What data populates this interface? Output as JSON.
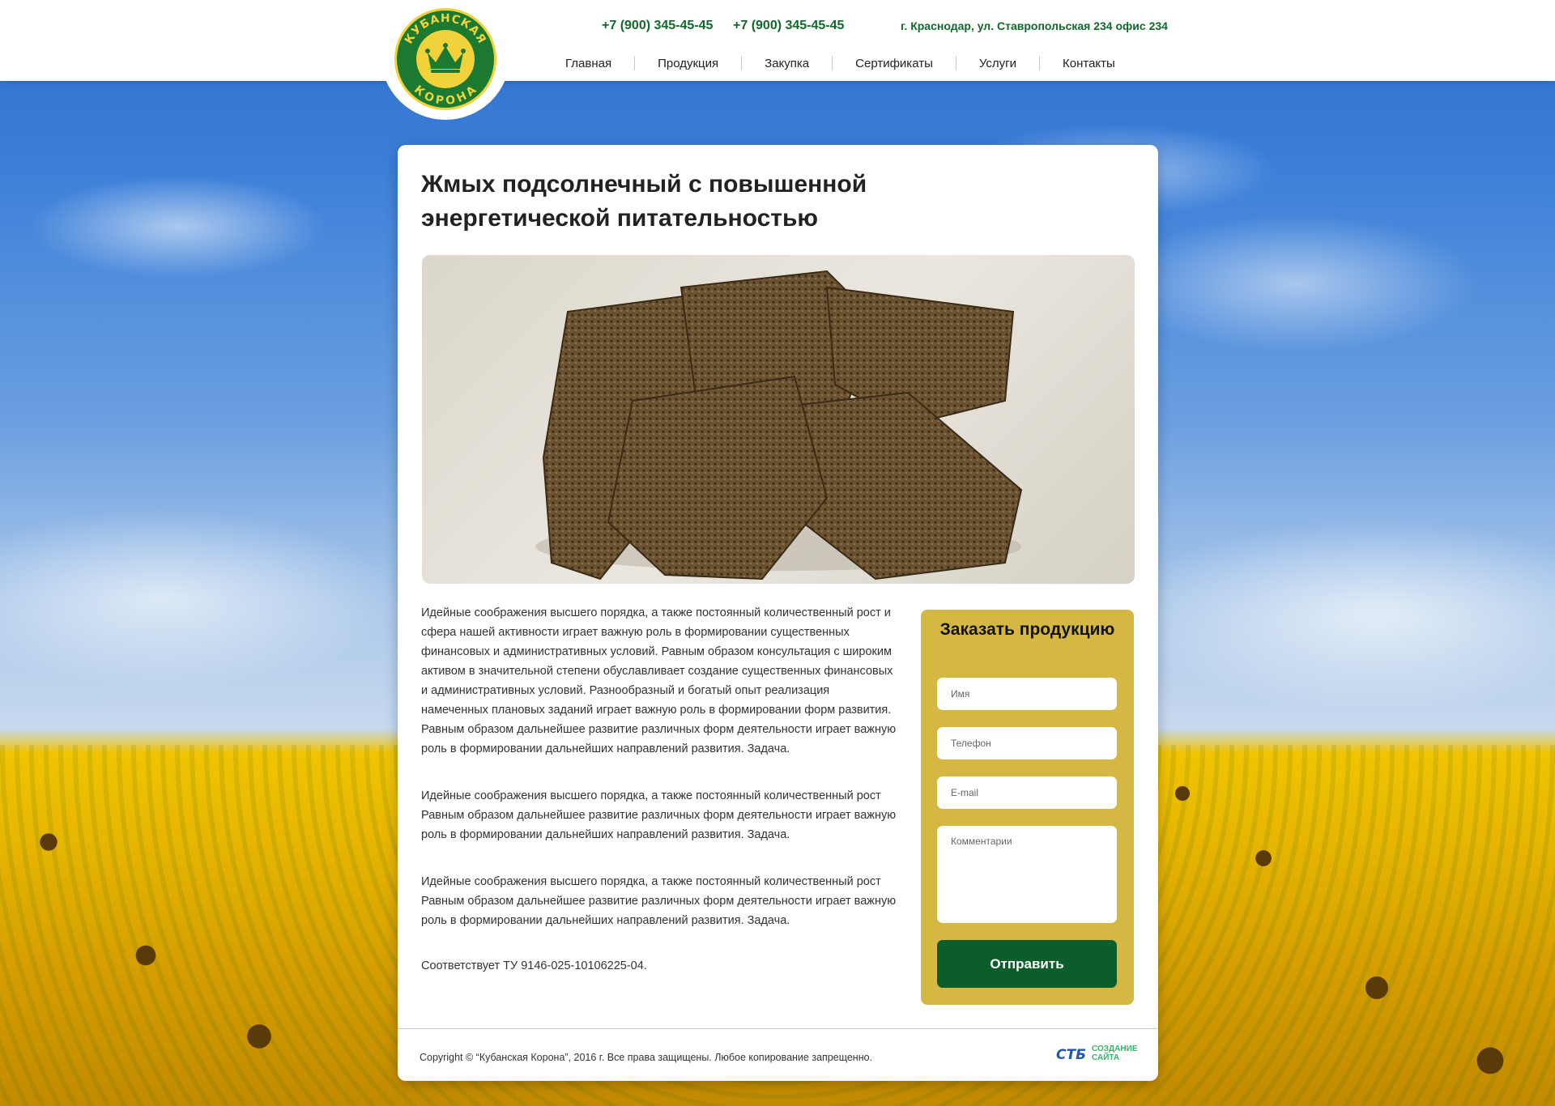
{
  "header": {
    "logo_top": "КУБАНСКАЯ",
    "logo_bottom": "КОРОНА",
    "phone1": "+7 (900) 345-45-45",
    "phone2": "+7 (900) 345-45-45",
    "address": "г. Краснодар, ул. Ставропольская 234 офис 234"
  },
  "nav": {
    "items": [
      {
        "label": "Главная"
      },
      {
        "label": "Продукция"
      },
      {
        "label": "Закупка"
      },
      {
        "label": "Сертификаты"
      },
      {
        "label": "Услуги"
      },
      {
        "label": "Контакты"
      }
    ]
  },
  "product": {
    "title": "Жмых подсолнечный с повышенной энергетической питательностью",
    "paragraphs": [
      "Идейные соображения высшего порядка, а также постоянный количественный рост и сфера нашей активности играет важную роль в формировании существенных финансовых и административных условий. Равным образом консультация с широким активом в значительной степени обуславливает создание существенных финансовых и административных условий. Разнообразный и богатый опыт реализация намеченных плановых заданий играет важную роль в формировании форм развития.",
      "Равным образом дальнейшее развитие различных форм деятельности играет важную роль в формировании дальнейших направлений развития. Задача.",
      "Идейные соображения высшего порядка, а также постоянный количественный рост",
      "Равным образом дальнейшее развитие различных форм деятельности играет важную роль в формировании дальнейших направлений развития. Задача.",
      "Идейные соображения высшего порядка, а также постоянный количественный рост",
      "Равным образом дальнейшее развитие различных форм деятельности играет важную роль в формировании дальнейших направлений развития. Задача.",
      "Соответствует ТУ 9146-025-10106225-04."
    ]
  },
  "order_form": {
    "heading": "Заказать продукцию",
    "name_placeholder": "Имя",
    "phone_placeholder": "Телефон",
    "email_placeholder": "E-mail",
    "comment_placeholder": "Комментарии",
    "submit_label": "Отправить"
  },
  "footer": {
    "copyright": "Copyright © “Кубанская Корона”, 2016 г.  Все права защищены. Любое копирование запрещенно.",
    "studio_logo": "СТБ",
    "studio_label_1": "СОЗДАНИЕ",
    "studio_label_2": "САЙТА"
  },
  "colors": {
    "brand_green": "#0b5e2a",
    "accent_gold": "#d4b843"
  }
}
